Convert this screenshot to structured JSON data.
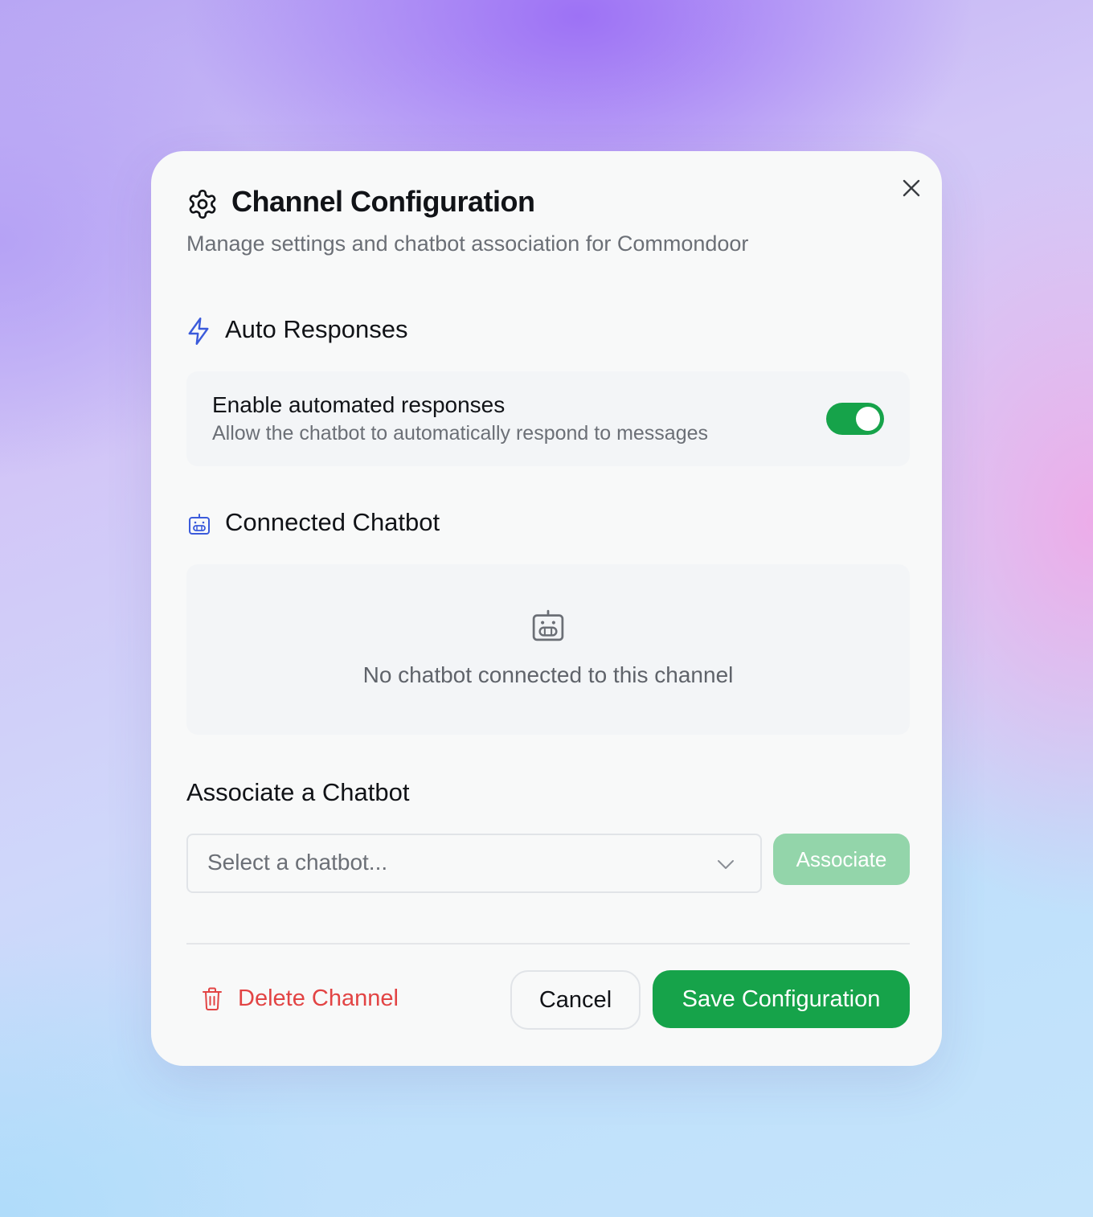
{
  "dialog": {
    "title": "Channel Configuration",
    "subtitle": "Manage settings and chatbot association for Commondoor",
    "close_icon": "close-icon",
    "title_icon": "gear-icon"
  },
  "auto_responses": {
    "heading": "Auto Responses",
    "icon": "lightning-icon",
    "toggle_title": "Enable automated responses",
    "toggle_description": "Allow the chatbot to automatically respond to messages",
    "toggle_on": true
  },
  "connected_chatbot": {
    "heading": "Connected Chatbot",
    "icon": "bot-icon",
    "empty_text": "No chatbot connected to this channel"
  },
  "associate": {
    "heading": "Associate a Chatbot",
    "select_placeholder": "Select a chatbot...",
    "button_label": "Associate"
  },
  "footer": {
    "delete_label": "Delete Channel",
    "cancel_label": "Cancel",
    "save_label": "Save Configuration"
  },
  "colors": {
    "primary_green": "#16a34a",
    "disabled_green": "#93d5aa",
    "danger_red": "#e24444",
    "accent_blue": "#3b5bdb"
  }
}
